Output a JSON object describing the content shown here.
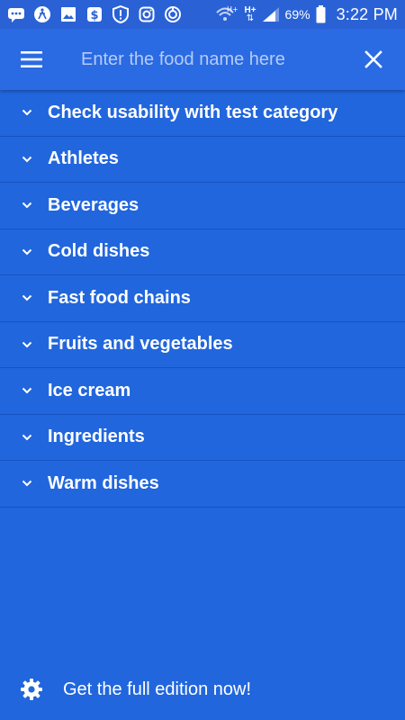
{
  "status_bar": {
    "battery_percent": "69%",
    "time": "3:22 PM",
    "network_1": "H+",
    "network_2": "H+",
    "icons": [
      "messaging-icon",
      "fitness-icon",
      "gallery-icon",
      "dollar-app-icon",
      "shield-alert-icon",
      "instagram-icon",
      "sync-icon",
      "wifi-icon",
      "signal-icon",
      "battery-icon"
    ]
  },
  "toolbar": {
    "search_placeholder": "Enter the food name here",
    "search_value": ""
  },
  "categories": [
    {
      "label": "Check usability with test category"
    },
    {
      "label": "Athletes"
    },
    {
      "label": "Beverages"
    },
    {
      "label": "Cold dishes"
    },
    {
      "label": "Fast food chains"
    },
    {
      "label": "Fruits and vegetables"
    },
    {
      "label": "Ice cream"
    },
    {
      "label": "Ingredients"
    },
    {
      "label": "Warm dishes"
    }
  ],
  "footer": {
    "label": "Get the full edition now!"
  },
  "colors": {
    "background": "#2166DD",
    "toolbar": "#2A6AE3",
    "text": "#FFFFFF"
  }
}
